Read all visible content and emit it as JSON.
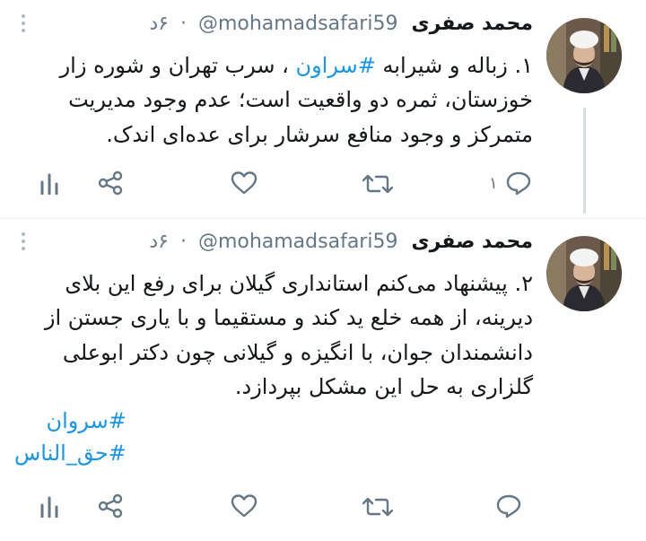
{
  "tweets": [
    {
      "author_name": "محمد صفری",
      "handle": "@mohamadsafari59",
      "separator": "·",
      "time": "۶د",
      "text_before": "۱. زباله و شیرابه ",
      "hashtag_inline": "#سراون",
      "text_after": " ، سرب تهران و شوره زار خوزستان، ثمره دو واقعیت است؛ عدم وجود مدیریت متمرکز و وجود منافع سرشار برای عده‌ای اندک.",
      "reply_count": "۱",
      "actions": [
        "reply-icon",
        "retweet-icon",
        "like-icon",
        "share-icon",
        "analytics-icon"
      ]
    },
    {
      "author_name": "محمد صفری",
      "handle": "@mohamadsafari59",
      "separator": "·",
      "time": "۶د",
      "text": "۲. پیشنهاد می‌کنم استانداری گیلان برای رفع این بلای دیرینه، از همه خلع ید کند و مستقیما و با یاری جستن از دانشمندان جوان، با انگیزه و گیلانی چون دکتر ابوعلی گلزاری به حل این مشکل بپردازد.",
      "hashtags": [
        "#سروان",
        "#حق_الناس"
      ],
      "actions": [
        "reply-icon",
        "retweet-icon",
        "like-icon",
        "share-icon",
        "analytics-icon"
      ]
    }
  ],
  "colors": {
    "link": "#1b95e0",
    "muted": "#657786",
    "divider": "#e6ecf0"
  }
}
